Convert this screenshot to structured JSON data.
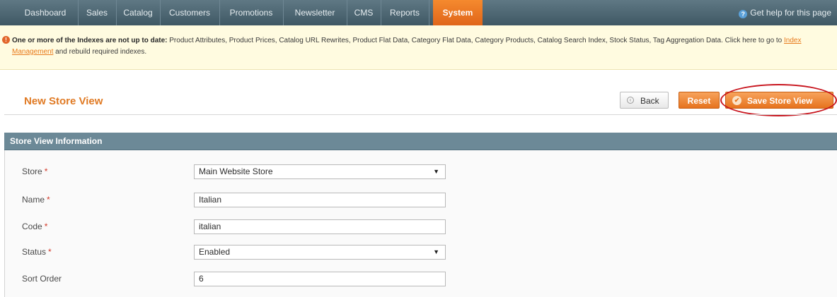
{
  "nav": {
    "items": [
      {
        "label": "Dashboard"
      },
      {
        "label": "Sales"
      },
      {
        "label": "Catalog"
      },
      {
        "label": "Customers"
      },
      {
        "label": "Promotions"
      },
      {
        "label": "Newsletter"
      },
      {
        "label": "CMS"
      },
      {
        "label": "Reports"
      },
      {
        "label": "System",
        "active": true
      }
    ],
    "help": "Get help for this page"
  },
  "notice": {
    "bold": "One or more of the Indexes are not up to date:",
    "text_before_link": " Product Attributes, Product Prices, Catalog URL Rewrites, Product Flat Data, Category Flat Data, Category Products, Catalog Search Index, Stock Status, Tag Aggregation Data. Click here to go to ",
    "link": "Index Management",
    "text_after_link": " and rebuild required indexes."
  },
  "page": {
    "title": "New Store View",
    "buttons": {
      "back": "Back",
      "reset": "Reset",
      "save": "Save Store View"
    }
  },
  "section": {
    "title": "Store View Information",
    "fields": {
      "store": {
        "label": "Store",
        "value": "Main Website Store",
        "required": "*"
      },
      "name": {
        "label": "Name",
        "value": "Italian",
        "required": "*"
      },
      "code": {
        "label": "Code",
        "value": "italian",
        "required": "*"
      },
      "status": {
        "label": "Status",
        "value": "Enabled",
        "required": "*"
      },
      "sort_order": {
        "label": "Sort Order",
        "value": "6"
      }
    }
  },
  "colors": {
    "accent": "#e6731e",
    "nav_bg": "#4f6874",
    "section_head": "#6c8997",
    "title": "#e07a24",
    "highlight": "#c8141d"
  },
  "icons": {
    "help": "help-icon",
    "notice": "error-icon",
    "back": "back-arrow-icon",
    "save": "check-circle-icon",
    "dropdown": "chevron-down-icon"
  }
}
